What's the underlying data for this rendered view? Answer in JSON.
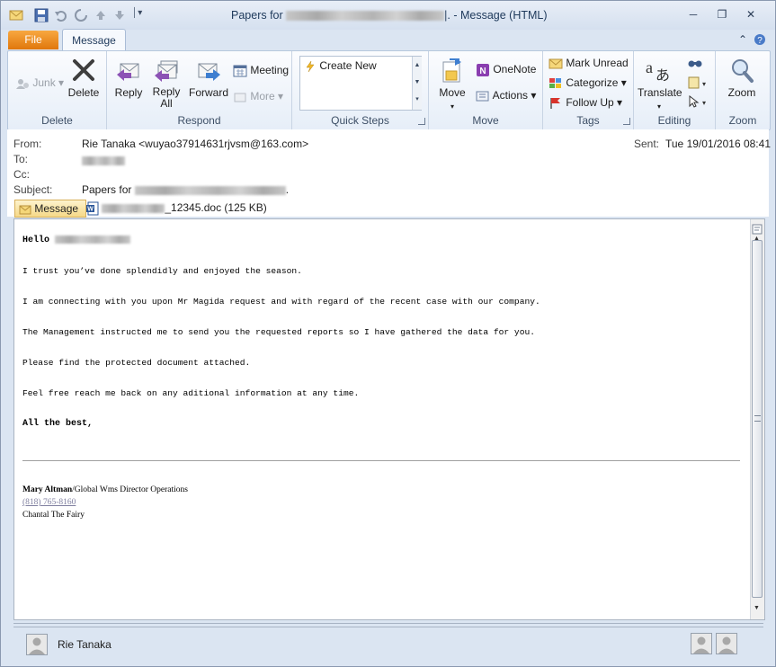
{
  "window": {
    "title_prefix": "Papers for",
    "title_suffix": "|. - Message (HTML)",
    "colors": {
      "file_tab": "#e97d16",
      "accent": "#1e395b",
      "link": "#8080a0"
    }
  },
  "tabs": {
    "file": "File",
    "message": "Message"
  },
  "ribbon": {
    "groups": {
      "delete": "Delete",
      "respond": "Respond",
      "quick_steps": "Quick Steps",
      "move": "Move",
      "tags": "Tags",
      "editing": "Editing",
      "zoom": "Zoom"
    },
    "junk": "Junk",
    "delete_btn": "Delete",
    "reply": "Reply",
    "reply_all_1": "Reply",
    "reply_all_2": "All",
    "forward": "Forward",
    "meeting": "Meeting",
    "more": "More",
    "create_new": "Create New",
    "move_btn": "Move",
    "onenote": "OneNote",
    "actions": "Actions",
    "mark_unread": "Mark Unread",
    "categorize": "Categorize",
    "follow_up": "Follow Up",
    "translate": "Translate",
    "zoom_btn": "Zoom"
  },
  "header": {
    "from_label": "From:",
    "from_value": "Rie Tanaka <wuyao37914631rjvsm@163.com>",
    "to_label": "To:",
    "cc_label": "Cc:",
    "subject_label": "Subject:",
    "subject_prefix": "Papers for",
    "subject_suffix": ".",
    "sent_label": "Sent:",
    "sent_value": "Tue 19/01/2016 08:41",
    "message_tab": "Message",
    "attachment_name": "_12345.doc (125 KB)"
  },
  "body": {
    "greeting": "Hello",
    "lines": [
      "I trust you’ve done splendidly and enjoyed the season.",
      "I am connecting with you upon Mr Magida request and with regard of the recent case with our company.",
      "The Management instructed me to send you the requested reports so I have gathered the data for you.",
      "Please find the protected document attached.",
      "Feel free reach me back on any aditional information at any time."
    ],
    "closing": "All the best,",
    "sig_name": "Mary Altman",
    "sig_title": "/Global Wms Director Operations",
    "sig_phone": "(818) 765-8160",
    "sig_company": "Chantal The Fairy"
  },
  "people_pane": {
    "name": "Rie Tanaka"
  }
}
